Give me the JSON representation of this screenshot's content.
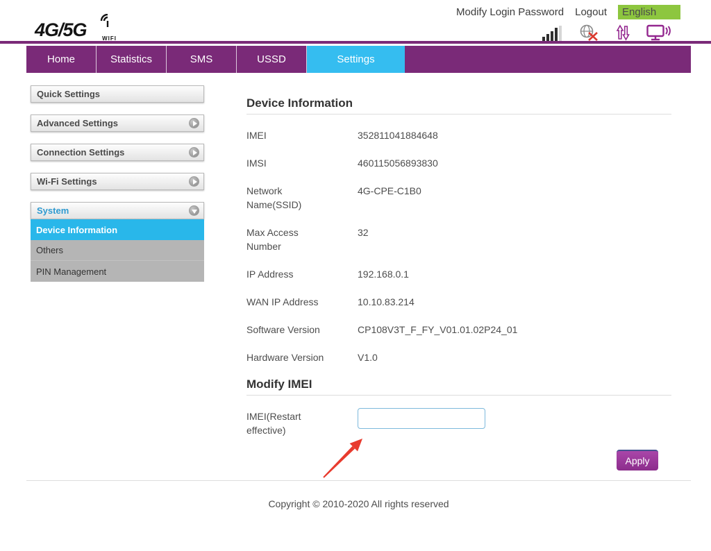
{
  "header": {
    "logo_text": "4G/5G",
    "logo_sub": "WIFI",
    "modify_password": "Modify Login Password",
    "logout": "Logout",
    "language": "English"
  },
  "nav": {
    "tabs": [
      {
        "label": "Home",
        "active": false
      },
      {
        "label": "Statistics",
        "active": false
      },
      {
        "label": "SMS",
        "active": false
      },
      {
        "label": "USSD",
        "active": false
      },
      {
        "label": "Settings",
        "active": true
      }
    ]
  },
  "sidebar": {
    "buttons": [
      {
        "label": "Quick Settings"
      },
      {
        "label": "Advanced Settings"
      },
      {
        "label": "Connection Settings"
      },
      {
        "label": "Wi-Fi Settings"
      }
    ],
    "system": {
      "label": "System",
      "items": [
        {
          "label": "Device Information",
          "active": true
        },
        {
          "label": "Others",
          "active": false
        },
        {
          "label": "PIN Management",
          "active": false
        }
      ]
    }
  },
  "main": {
    "device_info": {
      "title": "Device Information",
      "rows": [
        {
          "label": "IMEI",
          "value": "352811041884648"
        },
        {
          "label": "IMSI",
          "value": "460115056893830"
        },
        {
          "label": "Network Name(SSID)",
          "value": "4G-CPE-C1B0"
        },
        {
          "label": "Max Access Number",
          "value": "32"
        },
        {
          "label": "IP Address",
          "value": "192.168.0.1"
        },
        {
          "label": "WAN IP Address",
          "value": "10.10.83.214"
        },
        {
          "label": "Software Version",
          "value": "CP108V3T_F_FY_V01.01.02P24_01"
        },
        {
          "label": "Hardware Version",
          "value": "V1.0"
        }
      ]
    },
    "modify_imei": {
      "title": "Modify IMEI",
      "field_label": "IMEI(Restart effective)",
      "input_value": "",
      "apply_label": "Apply"
    }
  },
  "footer": {
    "copyright": "Copyright © 2010-2020 All rights reserved"
  },
  "colors": {
    "nav_purple": "#7a2a78",
    "active_cyan": "#35bdf0",
    "sidebar_active_cyan": "#29b7ea",
    "language_green": "#8dc63f",
    "apply_purple": "#8c2d8c",
    "annotation_red": "#e83b2e"
  }
}
